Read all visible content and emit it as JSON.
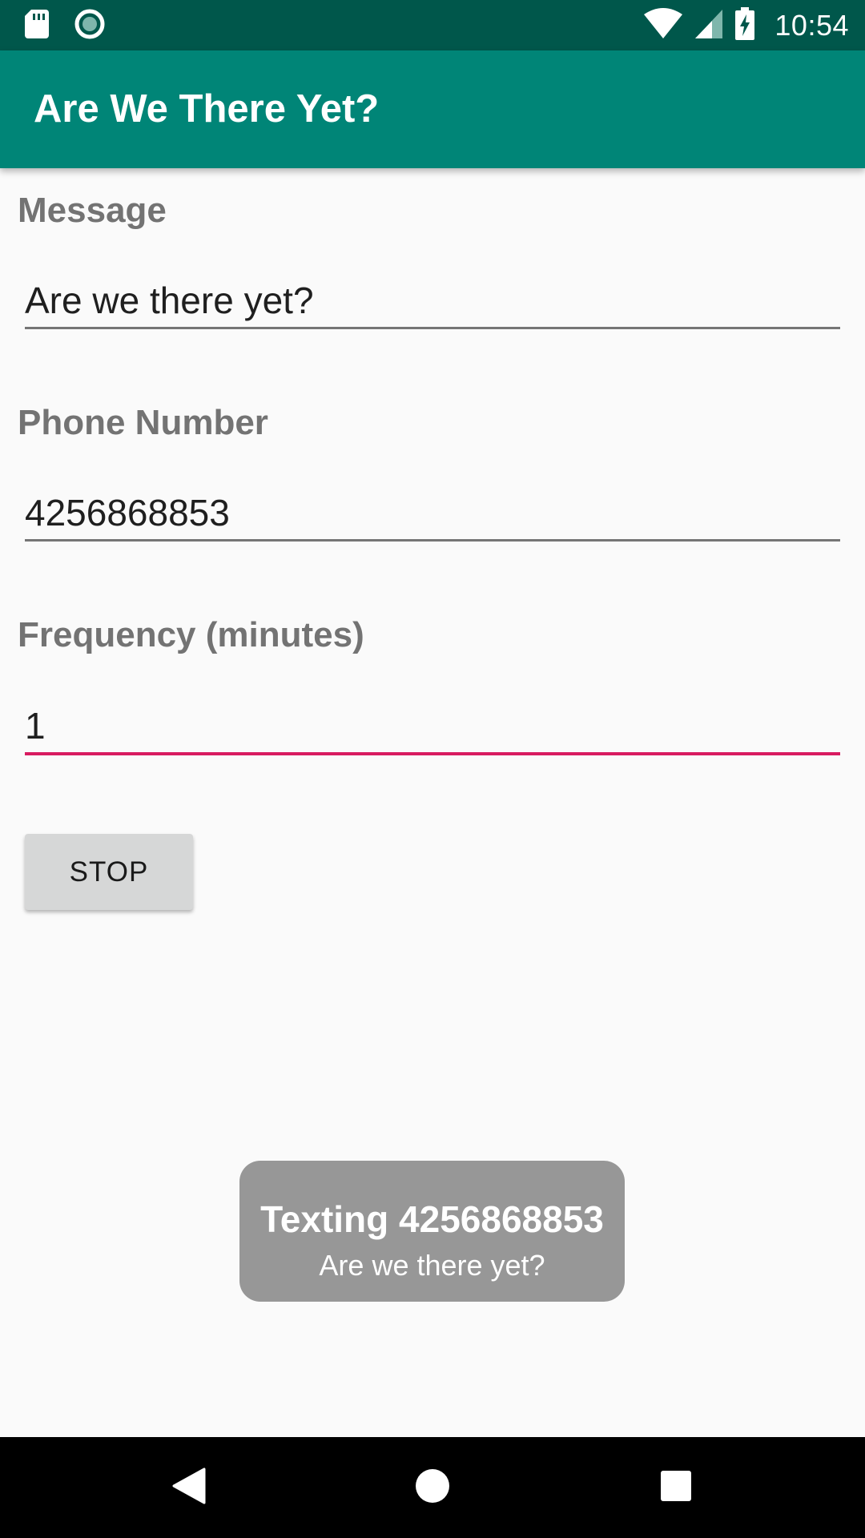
{
  "status_bar": {
    "time": "10:54",
    "left_icons": [
      "sd-card-icon",
      "record-icon"
    ],
    "right_icons": [
      "wifi-icon",
      "cell-signal-icon",
      "battery-charging-icon"
    ],
    "background": "#00574b"
  },
  "app_bar": {
    "title": "Are We There Yet?",
    "background": "#008577"
  },
  "form": {
    "message_label": "Message",
    "message_value": "Are we there yet?",
    "phone_label": "Phone Number",
    "phone_value": "4256868853",
    "frequency_label": "Frequency (minutes)",
    "frequency_value": "1",
    "focused_field": "frequency",
    "accent_color": "#d81b60"
  },
  "stop_button": {
    "label": "STOP"
  },
  "toast": {
    "title": "Texting 4256868853",
    "message": "Are we there yet?"
  },
  "nav_bar": {
    "buttons": [
      "back-icon",
      "home-icon",
      "recents-icon"
    ]
  }
}
